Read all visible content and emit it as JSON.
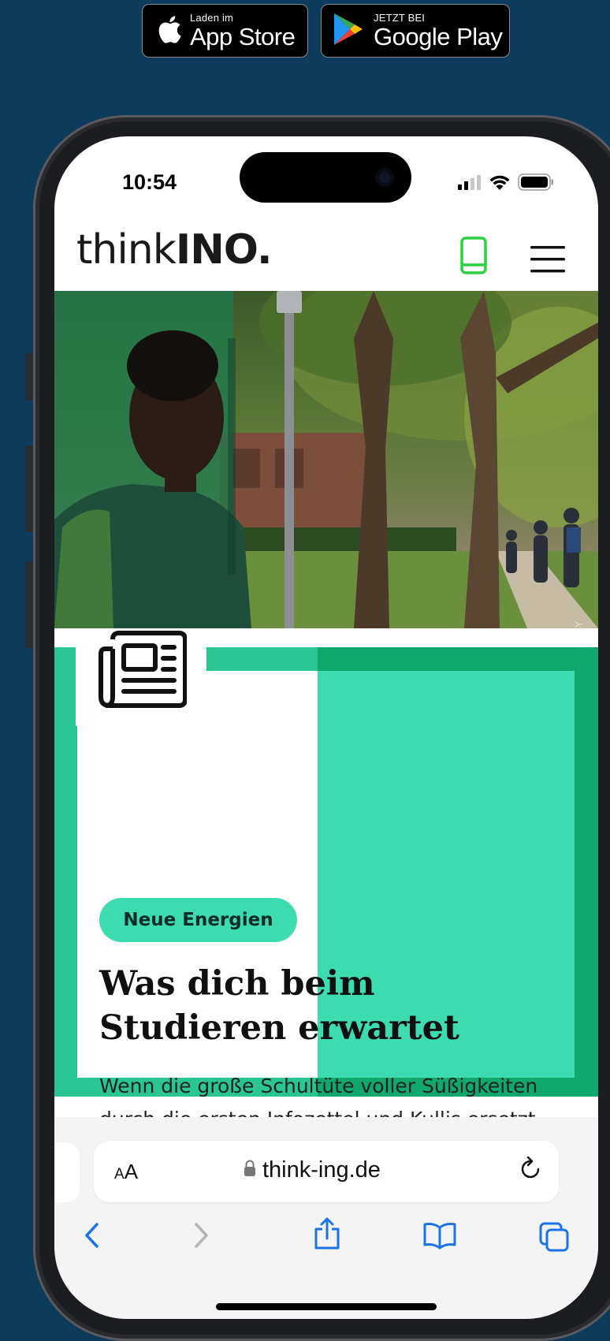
{
  "store_badges": {
    "apple": {
      "small": "Laden im",
      "big": "App Store"
    },
    "google": {
      "small": "JETZT BEI",
      "big": "Google Play"
    }
  },
  "status_bar": {
    "time": "10:54"
  },
  "site": {
    "logo_thin": "think",
    "logo_bold": "INO",
    "logo_dot": ".",
    "accent_color": "#2bc493"
  },
  "hero": {
    "credit": "PIXABAY"
  },
  "article": {
    "tag": "Neue Energien",
    "title": "Was dich beim Studieren erwartet",
    "excerpt": "Wenn die große Schultüte voller Süßigkeiten durch die ersten Infozettel und Kullis ersetzt wird, dann ist der Schritt von Schule zu Uni geschafft. Doch dass das Studileben ganz..."
  },
  "browser": {
    "text_size_label_small": "A",
    "text_size_label_big": "A",
    "url": "think-ing.de"
  }
}
